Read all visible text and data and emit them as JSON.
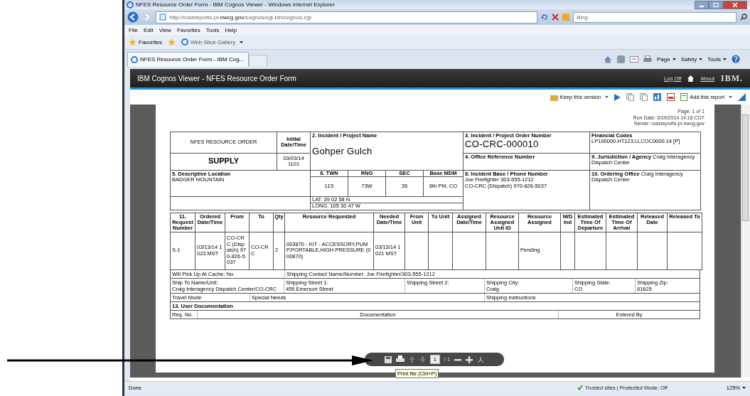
{
  "browser": {
    "title": "NFES Resource Order Form - IBM Cognos Viewer - Windows Internet Explorer",
    "url": "http://rossreports-pr.**nwcg.gov**/cognos/cgi-bin/cognos.cgi",
    "search_placeholder": "Bing",
    "menu": [
      "File",
      "Edit",
      "View",
      "Favorites",
      "Tools",
      "Help"
    ],
    "favorites": "Favorites",
    "web_slice": "Web Slice Gallery",
    "tab": "NFES Resource Order Form - IBM Cog...",
    "commands": [
      "Page",
      "Safety",
      "Tools"
    ]
  },
  "cognos": {
    "title": "IBM Cognos Viewer - NFES Resource Order Form",
    "links": [
      "Log Off",
      "About"
    ],
    "logo": "IBM.",
    "toolbar": [
      "Keep this version",
      "Add this report"
    ]
  },
  "report": {
    "page_info": [
      "Page: 1 of 1",
      "Run Date: 3/19/2014 14:16 CDT",
      "Server: rossreports-pr.nwcg.gov"
    ],
    "header": {
      "form_title": "NFES RESOURCE ORDER",
      "order_type": "SUPPLY",
      "initial_label": "Initial Date/Time",
      "initial_value": "03/03/14 1101",
      "incident_label": "2. Incident / Project Name",
      "incident_name": "Gohper Gulch",
      "order_number_label": "3. Incident / Project Order Number",
      "order_number": "CO-CRC-000010",
      "financial_label": "Financial Codes",
      "financial_value": "LP100000.HT123.LLCOC0000.14 [P]",
      "office_ref_label": "4. Office Reference Number",
      "jurisdiction": "**9. Jurisdiction / Agency**  Craig Interagency Dispatch Center",
      "location_label": "5. Descriptive Location",
      "location_value": "BADGER MOUNTAIN",
      "legal_columns": [
        "6. TWN",
        "RNG",
        "SEC",
        "Base MDM"
      ],
      "legal_values": [
        "11S",
        "73W",
        "35",
        "6th PM, CO"
      ],
      "lat": "LAT.   39 02 58 N",
      "long": "LONG.   105 30 47 W",
      "base_label": "8. Incident Base / Phone Number",
      "base_lines": [
        "Joe Firefighter 303-555-1212",
        "CO-CRC (Dispatch) 970-826-5037"
      ],
      "ordering": "**10. Ordering Office**  Craig Interagency Dispatch Center"
    },
    "columns": [
      "11. Request Number",
      "Ordered Date/Time",
      "From",
      "To",
      "Qty",
      "Resource Requested",
      "Needed Date/Time",
      "From Unit",
      "To Unit",
      "Assigned Date/Time",
      "Resource Assigned Unit ID",
      "Resource Assigned",
      "M/D Ind",
      "Estimated Time Of Departure",
      "Estimated Time Of Arrival",
      "Released Date",
      "Released To"
    ],
    "rows": [
      [
        "S-1",
        "03/13/14 1023  MST",
        "CO-CRC (Dispatch) 970-826-5037",
        "CO-CRC",
        "2",
        "003870 - KIT - ACCESSORY,PUMP,PORTABLE,HIGH PRESSURE (000870)",
        "03/13/14 1021  MST",
        null,
        null,
        null,
        null,
        "Pending",
        null,
        null,
        null,
        null,
        null
      ]
    ],
    "pickup": "Will Pick Up At Cache:  No",
    "contact": "Shipping Contact Name/Number:  Joe Firefighter/303-555-1212",
    "shipping": [
      {
        "label": "Ship To Name/Unit:",
        "value": "Craig Interagency Dispatch Center/CO-CRC"
      },
      {
        "label": "Shipping Street 1:",
        "value": "455 Emerson Street"
      },
      {
        "label": "Shipping Street 2:"
      },
      {
        "label": "Shipping City:",
        "value": "Craig"
      },
      {
        "label": "Shipping State:",
        "value": "CO"
      },
      {
        "label": "Shipping Zip:",
        "value": "81625"
      }
    ],
    "travel": [
      "Travel Mode",
      "Special Needs",
      "Shipping Instructions"
    ],
    "documentation_title": "13. User Documentation",
    "documentation_columns": [
      "Req. No.",
      "Documentation",
      "Entered By"
    ]
  },
  "viewer_toolbar": {
    "page": "1",
    "total": "/ 1",
    "tooltip": "Print file (Ctrl+P)"
  },
  "status_bar": {
    "text": "Done",
    "zone": "Trusted sites | Protected Mode: Off",
    "zoom": "125%"
  }
}
